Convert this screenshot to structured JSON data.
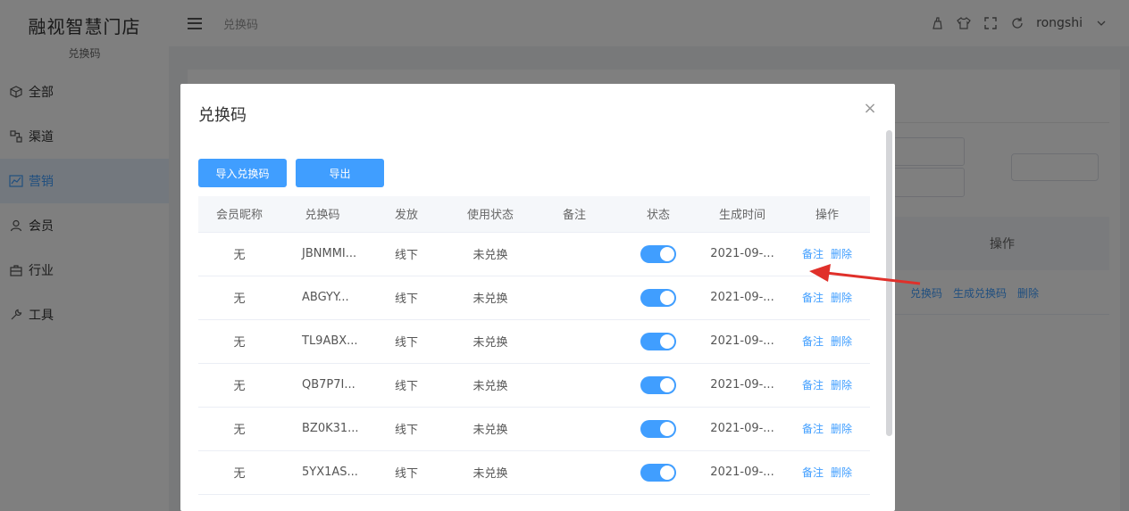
{
  "app": {
    "name": "融视智慧门店",
    "subtitle": "兑换码"
  },
  "sidebar": {
    "items": [
      {
        "label": "全部",
        "icon": "cube-icon"
      },
      {
        "label": "渠道",
        "icon": "channel-icon"
      },
      {
        "label": "营销",
        "icon": "chart-icon"
      },
      {
        "label": "会员",
        "icon": "user-icon"
      },
      {
        "label": "行业",
        "icon": "briefcase-icon"
      },
      {
        "label": "工具",
        "icon": "wrench-icon"
      }
    ],
    "active": "营销"
  },
  "topbar": {
    "breadcrumb": "兑换码",
    "user": "rongshi"
  },
  "background": {
    "table_header": "操作",
    "links": [
      "兑换码",
      "生成兑换码",
      "删除"
    ]
  },
  "dialog": {
    "title": "兑换码",
    "buttons": {
      "import": "导入兑换码",
      "export": "导出"
    },
    "columns": [
      "会员昵称",
      "兑换码",
      "发放",
      "使用状态",
      "备注",
      "状态",
      "生成时间",
      "操作"
    ],
    "rows": [
      {
        "nickname": "无",
        "code": "JBNMMI...",
        "issue": "线下",
        "usage": "未兑换",
        "note": "",
        "enabled": true,
        "created": "2021-09-...",
        "actions": [
          "备注",
          "删除"
        ]
      },
      {
        "nickname": "无",
        "code": "ABGYY...",
        "issue": "线下",
        "usage": "未兑换",
        "note": "",
        "enabled": true,
        "created": "2021-09-...",
        "actions": [
          "备注",
          "删除"
        ]
      },
      {
        "nickname": "无",
        "code": "TL9ABX...",
        "issue": "线下",
        "usage": "未兑换",
        "note": "",
        "enabled": true,
        "created": "2021-09-...",
        "actions": [
          "备注",
          "删除"
        ]
      },
      {
        "nickname": "无",
        "code": "QB7P7I...",
        "issue": "线下",
        "usage": "未兑换",
        "note": "",
        "enabled": true,
        "created": "2021-09-...",
        "actions": [
          "备注",
          "删除"
        ]
      },
      {
        "nickname": "无",
        "code": "BZ0K31...",
        "issue": "线下",
        "usage": "未兑换",
        "note": "",
        "enabled": true,
        "created": "2021-09-...",
        "actions": [
          "备注",
          "删除"
        ]
      },
      {
        "nickname": "无",
        "code": "5YX1AS...",
        "issue": "线下",
        "usage": "未兑换",
        "note": "",
        "enabled": true,
        "created": "2021-09-...",
        "actions": [
          "备注",
          "删除"
        ]
      }
    ]
  },
  "colors": {
    "accent": "#409eff",
    "annotation_arrow": "#e0302a"
  }
}
